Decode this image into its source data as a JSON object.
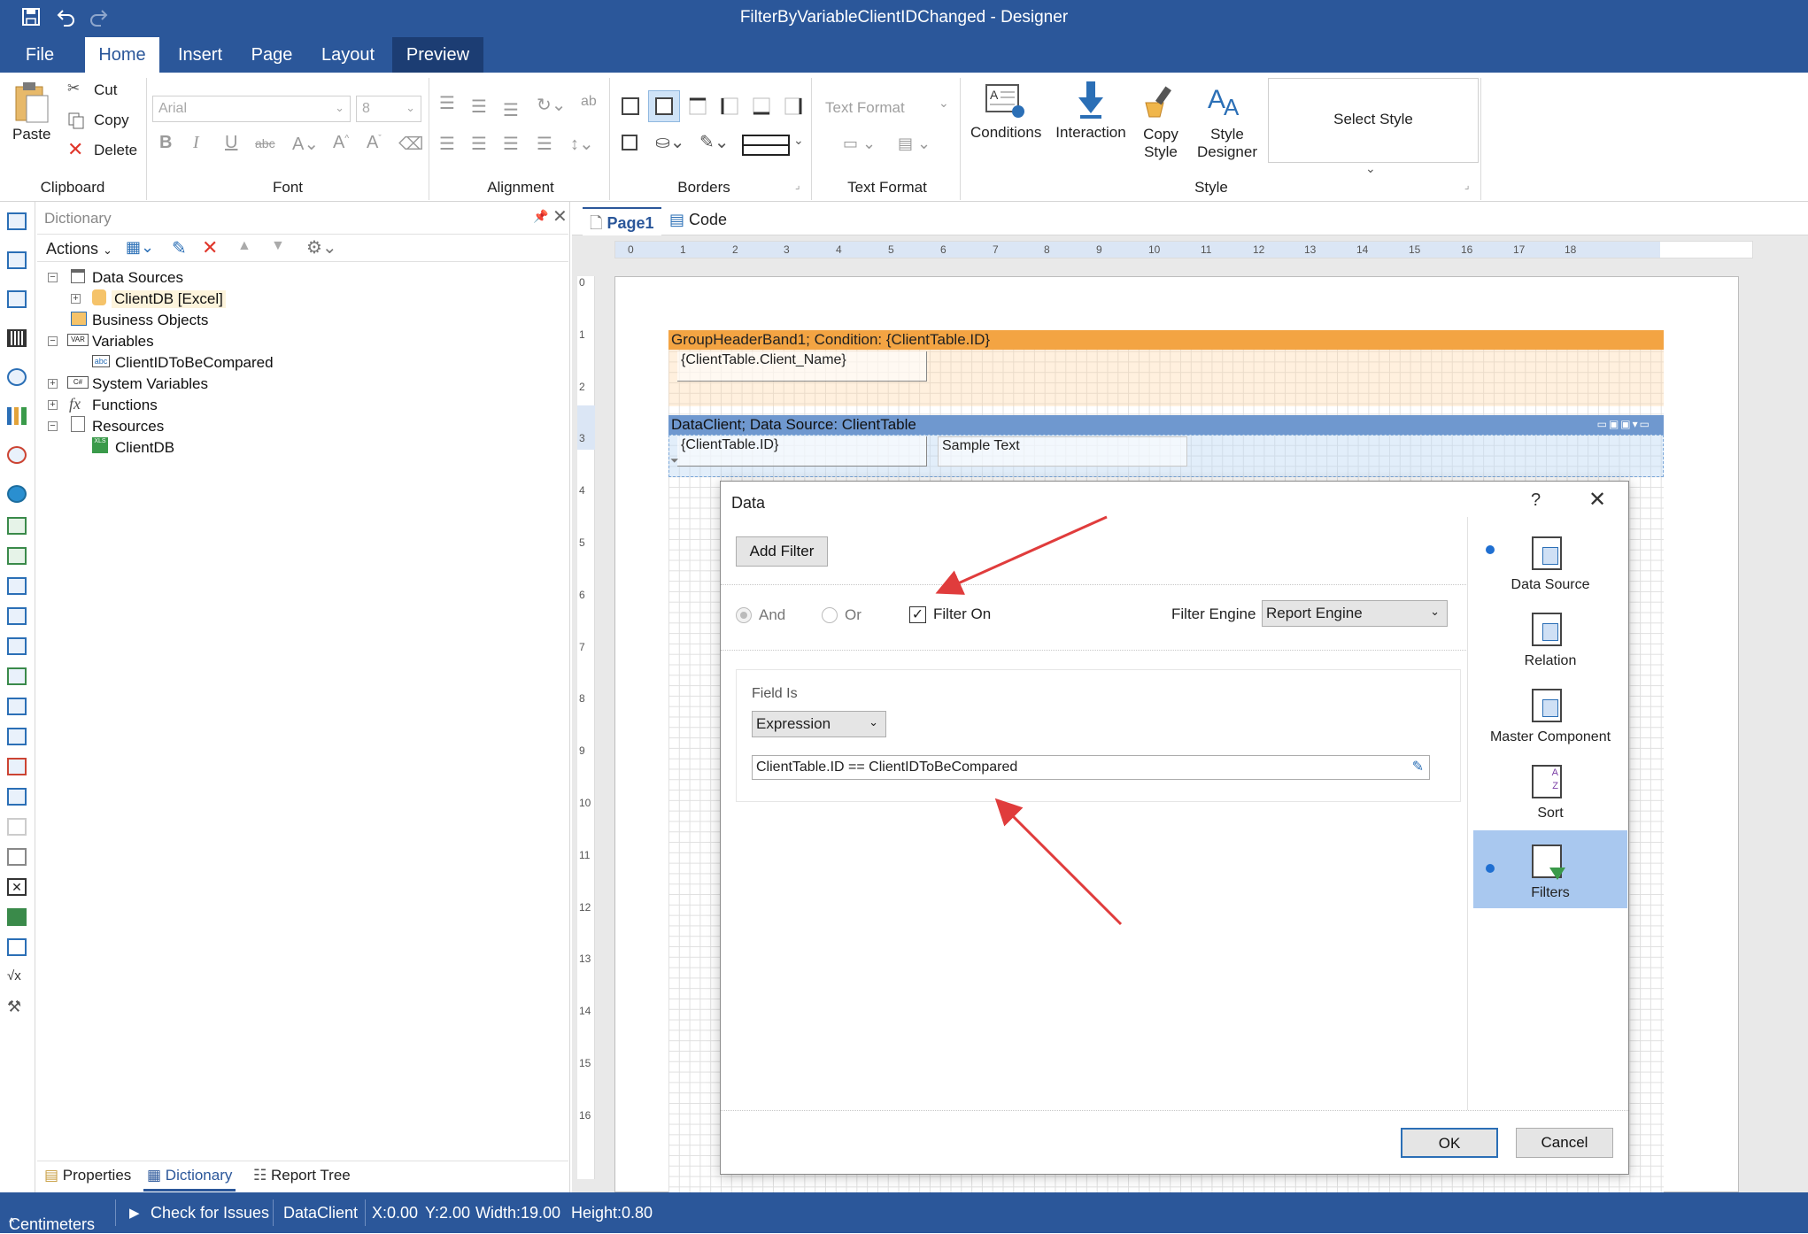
{
  "window": {
    "title": "FilterByVariableClientIDChanged - Designer"
  },
  "tabs": [
    {
      "label": "File"
    },
    {
      "label": "Home"
    },
    {
      "label": "Insert"
    },
    {
      "label": "Page"
    },
    {
      "label": "Layout"
    },
    {
      "label": "Preview"
    }
  ],
  "ribbon": {
    "clipboard": {
      "paste": "Paste",
      "cut": "Cut",
      "copy": "Copy",
      "delete": "Delete",
      "label": "Clipboard"
    },
    "font": {
      "family": "Arial",
      "size": "8",
      "label": "Font"
    },
    "alignment": {
      "label": "Alignment"
    },
    "borders": {
      "label": "Borders"
    },
    "text_format": {
      "placeholder": "Text Format",
      "label": "Text Format"
    },
    "style": {
      "conditions": "Conditions",
      "interaction": "Interaction",
      "copy_style_1": "Copy",
      "copy_style_2": "Style",
      "style_designer_1": "Style",
      "style_designer_2": "Designer",
      "select_style": "Select Style",
      "label": "Style"
    }
  },
  "dictionary": {
    "title": "Dictionary",
    "actions": "Actions",
    "tree": [
      {
        "label": "Data Sources"
      },
      {
        "label": "ClientDB [Excel]"
      },
      {
        "label": "Business Objects"
      },
      {
        "label": "Variables"
      },
      {
        "label": "ClientIDToBeCompared"
      },
      {
        "label": "System Variables"
      },
      {
        "label": "Functions"
      },
      {
        "label": "Resources"
      },
      {
        "label": "ClientDB"
      }
    ],
    "bottom_tabs": [
      "Properties",
      "Dictionary",
      "Report Tree"
    ]
  },
  "designer": {
    "tabs": [
      "Page1",
      "Code"
    ],
    "ruler_top": [
      "0",
      "1",
      "2",
      "3",
      "4",
      "5",
      "6",
      "7",
      "8",
      "9",
      "10",
      "11",
      "12",
      "13",
      "14",
      "15",
      "16",
      "17",
      "18"
    ],
    "ruler_left": [
      "0",
      "1",
      "2",
      "3",
      "4",
      "5",
      "6",
      "7",
      "8",
      "9",
      "10",
      "11",
      "12",
      "13",
      "14",
      "15",
      "16"
    ],
    "group_header": "GroupHeaderBand1; Condition: {ClientTable.ID}",
    "client_name_field": "{ClientTable.Client_Name}",
    "data_band": "DataClient; Data Source: ClientTable",
    "id_field": "{ClientTable.ID}",
    "sample_text": "Sample Text"
  },
  "dialog": {
    "title": "Data",
    "help": "?",
    "add_filter": "Add Filter",
    "and": "And",
    "or": "Or",
    "filter_on": "Filter On",
    "filter_on_checked": true,
    "filter_engine_label": "Filter Engine",
    "filter_engine_value": "Report Engine",
    "field_is_label": "Field Is",
    "field_is_value": "Expression",
    "expression": "ClientTable.ID == ClientIDToBeCompared",
    "ok": "OK",
    "cancel": "Cancel",
    "side_items": [
      {
        "label": "Data Source"
      },
      {
        "label": "Relation"
      },
      {
        "label": "Master Component"
      },
      {
        "label": "Sort"
      },
      {
        "label": "Filters"
      }
    ]
  },
  "status": {
    "units": "Centimeters",
    "check": "Check for Issues",
    "component": "DataClient",
    "x": "X:0.00",
    "y": "Y:2.00",
    "width": "Width:19.00",
    "height": "Height:0.80"
  }
}
